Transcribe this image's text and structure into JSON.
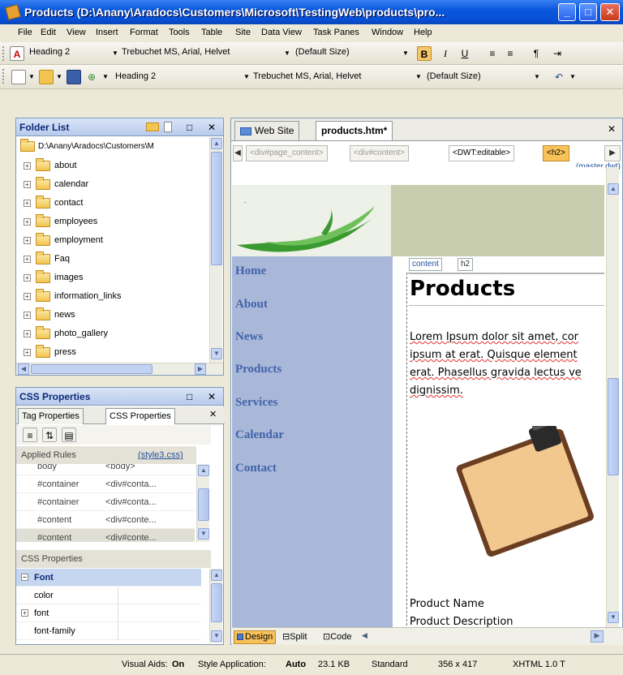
{
  "window": {
    "title": "Products (D:\\Anany\\Aradocs\\Customers\\Microsoft\\TestingWeb\\products\\pro...",
    "minimize": "_",
    "maximize": "□",
    "close": "✕"
  },
  "menu": [
    "File",
    "Edit",
    "View",
    "Insert",
    "Format",
    "Tools",
    "Table",
    "Site",
    "Data View",
    "Task Panes",
    "Window",
    "Help"
  ],
  "toolbar1": {
    "style": "Heading 2",
    "font": "Trebuchet MS, Arial, Helvet",
    "size": "(Default Size)",
    "bold": "B",
    "italic": "I",
    "underline": "U"
  },
  "toolbar2": {
    "style": "Heading 2",
    "font": "Trebuchet MS, Arial, Helvet",
    "size": "(Default Size)"
  },
  "folder_list": {
    "title": "Folder List",
    "root": "D:\\Anany\\Aradocs\\Customers\\M",
    "folders": [
      "about",
      "calendar",
      "contact",
      "employees",
      "employment",
      "Faq",
      "images",
      "information_links",
      "news",
      "photo_gallery",
      "press"
    ]
  },
  "css_properties": {
    "title": "CSS Properties",
    "tabs": [
      "Tag Properties",
      "CSS Properties"
    ],
    "applied_rules_label": "Applied Rules",
    "applied_rules_file": "(style3.css)",
    "rules": [
      {
        "selector": "body",
        "context": "<body>"
      },
      {
        "selector": "#container",
        "context": "<div#conta..."
      },
      {
        "selector": "#container",
        "context": "<div#conta..."
      },
      {
        "selector": "#content",
        "context": "<div#conte..."
      },
      {
        "selector": "#content",
        "context": "<div#conte..."
      }
    ],
    "properties_label": "CSS Properties",
    "properties": [
      {
        "name": "Font",
        "group": true
      },
      {
        "name": "color"
      },
      {
        "name": "font",
        "expandable": true
      },
      {
        "name": "font-family"
      }
    ]
  },
  "document": {
    "tabs": [
      "Web Site",
      "products.htm*"
    ],
    "breadcrumbs": [
      "<div#page_content>",
      "<div#content>",
      "<DWT:editable>",
      "<h2>"
    ],
    "masterpage": "..(master.dwt)",
    "nav_links": [
      "Home",
      "About",
      "News",
      "Products",
      "Services",
      "Calendar",
      "Contact"
    ],
    "content_tag_label": "content",
    "h2_tag_label": "h2",
    "heading": "Products",
    "lorem_lines": [
      "Lorem Ipsum dolor sit amet, cor",
      "ipsum at erat. Quisque element",
      "erat. Phasellus gravida lectus ve",
      "dignissim."
    ],
    "product_name": "Product Name",
    "product_description": "Product Description",
    "views": [
      "Design",
      "Split",
      "Code"
    ]
  },
  "status": {
    "visual_aids_label": "Visual Aids:",
    "visual_aids_value": "On",
    "style_app_label": "Style Application:",
    "style_app_value": "Auto",
    "size": "23.1 KB",
    "mode": "Standard",
    "dimensions": "356 x 417",
    "doctype": "XHTML 1.0 T"
  },
  "colors": {
    "titlebar": "#0a58dc",
    "panel_header": "#c6d5f0",
    "nav_bg": "#a9b8d9",
    "nav_link": "#4163a8",
    "banner_right": "#c9cdb0",
    "active_highlight": "#f7c25a"
  }
}
